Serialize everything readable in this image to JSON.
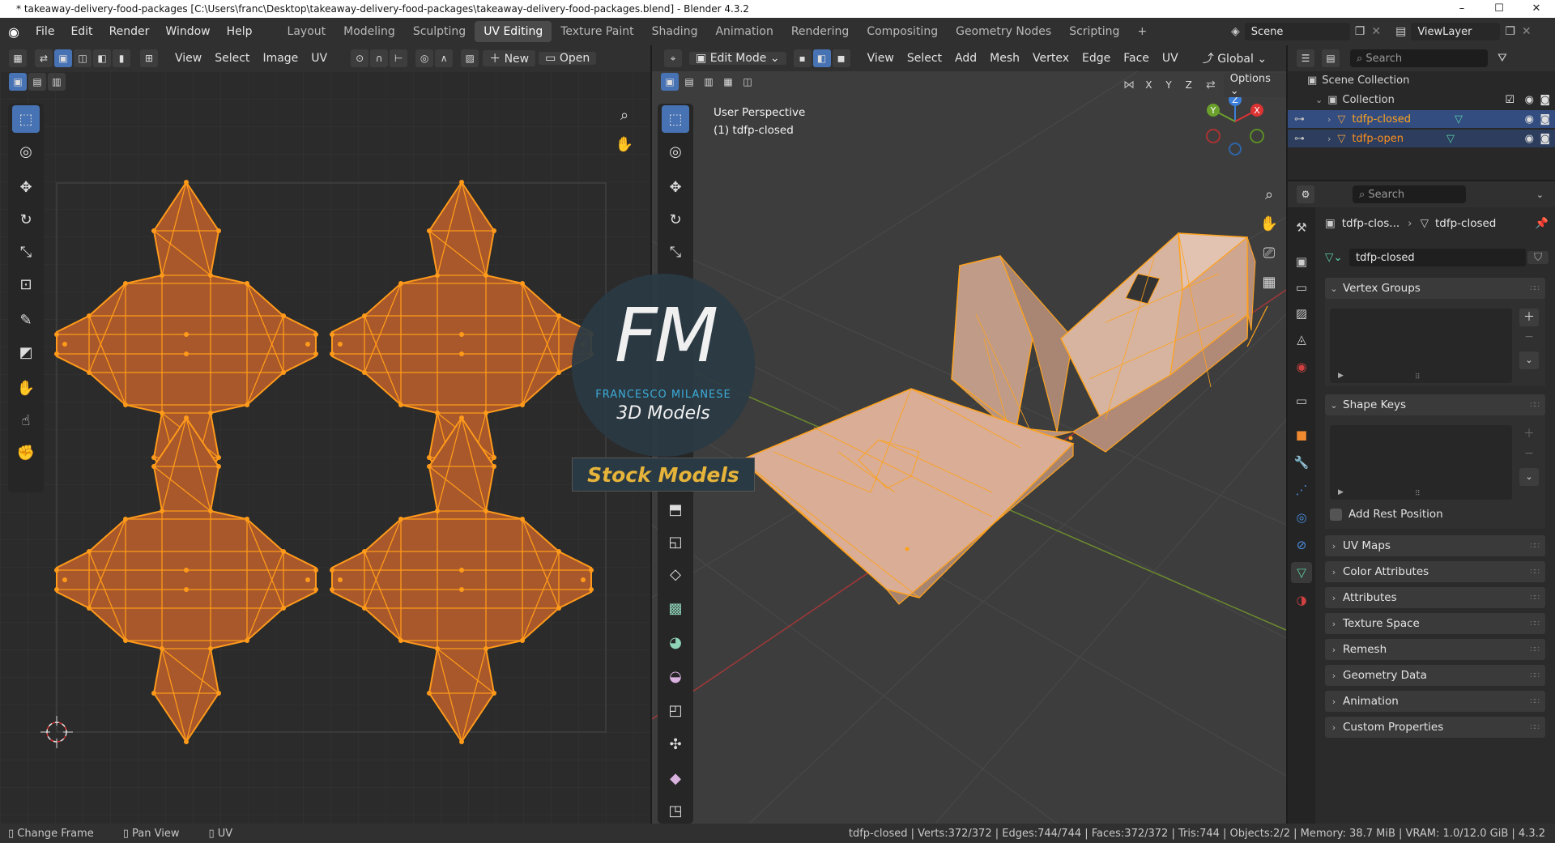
{
  "title_bar": {
    "text": "* takeaway-delivery-food-packages [C:\\Users\\franc\\Desktop\\takeaway-delivery-food-packages\\takeaway-delivery-food-packages.blend] - Blender 4.3.2",
    "minimize": "–",
    "maximize": "☐",
    "close": "✕"
  },
  "top_menu": {
    "items": [
      "File",
      "Edit",
      "Render",
      "Window",
      "Help"
    ],
    "workspaces": [
      "Layout",
      "Modeling",
      "Sculpting",
      "UV Editing",
      "Texture Paint",
      "Shading",
      "Animation",
      "Rendering",
      "Compositing",
      "Geometry Nodes",
      "Scripting"
    ],
    "add_tab": "+",
    "scene_label": "Scene",
    "viewlayer_label": "ViewLayer"
  },
  "uv_editor": {
    "menus": [
      "View",
      "Select",
      "Image",
      "UV"
    ],
    "new_label": "New",
    "open_label": "Open"
  },
  "viewport": {
    "mode": "Edit Mode",
    "menus": [
      "View",
      "Select",
      "Add",
      "Mesh",
      "Vertex",
      "Edge",
      "Face",
      "UV"
    ],
    "transform_orientation": "Global",
    "options_label": "Options",
    "axis_toggles": [
      "X",
      "Y",
      "Z"
    ],
    "overlay_line1": "User Perspective",
    "overlay_line2": "(1) tdfp-closed",
    "gizmo": {
      "x": "X",
      "y": "Y",
      "z": "Z"
    }
  },
  "watermark": {
    "logo": "FM",
    "name": "FRANCESCO MILANESE",
    "subtitle": "3D Models",
    "banner": "Stock Models"
  },
  "outliner": {
    "search_placeholder": "Search",
    "scene_collection": "Scene Collection",
    "collection": "Collection",
    "objects": [
      "tdfp-closed",
      "tdfp-open"
    ]
  },
  "properties": {
    "search_placeholder": "Search",
    "breadcrumb_object": "tdfp-clos...",
    "breadcrumb_data": "tdfp-closed",
    "mesh_name": "tdfp-closed",
    "panels": {
      "vertex_groups": "Vertex Groups",
      "shape_keys": "Shape Keys",
      "add_rest_position": "Add Rest Position",
      "collapsed": [
        "UV Maps",
        "Color Attributes",
        "Attributes",
        "Texture Space",
        "Remesh",
        "Geometry Data",
        "Animation",
        "Custom Properties"
      ]
    }
  },
  "status_bar": {
    "left": [
      "Change Frame",
      "Pan View",
      "UV"
    ],
    "right": "tdfp-closed | Verts:372/372 | Edges:744/744 | Faces:372/372 | Tris:744 | Objects:2/2 | Memory: 38.7 MiB | VRAM: 1.0/12.0 GiB | 4.3.2"
  },
  "colors": {
    "accent": "#4772b3",
    "uv_face": "#a8582a",
    "uv_edge": "#ff9a1a",
    "mesh_face": "#d9ad96",
    "selected_text": "#ff9a1a",
    "header": "#303030",
    "background": "#1d1d1d"
  }
}
